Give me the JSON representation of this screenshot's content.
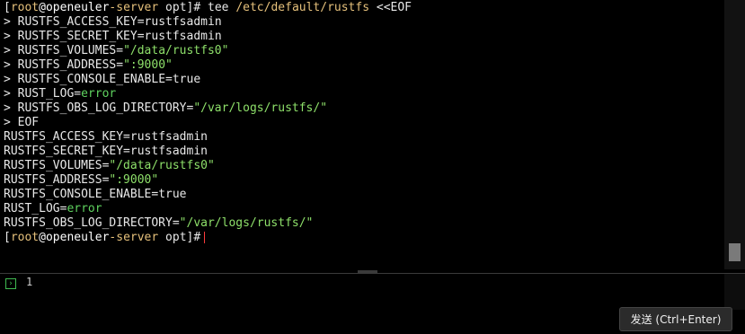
{
  "terminal": {
    "prompt": {
      "open": "[",
      "user": "root",
      "at": "@",
      "host_a": "openeuler",
      "dash": "-",
      "host_b": "server",
      "dir": " opt",
      "close": "]#"
    },
    "command_line": {
      "cmd": " tee ",
      "file": "/etc/default/rustfs",
      "heredoc": " <<EOF"
    },
    "heredoc_lines": [
      {
        "prefix": "> ",
        "key": "RUSTFS_ACCESS_KEY=",
        "value": "rustfsadmin",
        "style": "plain"
      },
      {
        "prefix": "> ",
        "key": "RUSTFS_SECRET_KEY=",
        "value": "rustfsadmin",
        "style": "plain"
      },
      {
        "prefix": "> ",
        "key": "RUSTFS_VOLUMES=",
        "value": "\"/data/rustfs0\"",
        "style": "str"
      },
      {
        "prefix": "> ",
        "key": "RUSTFS_ADDRESS=",
        "value": "\":9000\"",
        "style": "str"
      },
      {
        "prefix": "> ",
        "key": "RUSTFS_CONSOLE_ENABLE=",
        "value": "true",
        "style": "plain"
      },
      {
        "prefix": "> ",
        "key": "RUST_LOG=",
        "value": "error",
        "style": "err"
      },
      {
        "prefix": "> ",
        "key": "RUSTFS_OBS_LOG_DIRECTORY=",
        "value": "\"/var/logs/rustfs/\"",
        "style": "str"
      }
    ],
    "heredoc_end": "> EOF",
    "output_lines": [
      {
        "key": "RUSTFS_ACCESS_KEY=",
        "value": "rustfsadmin",
        "style": "plain"
      },
      {
        "key": "RUSTFS_SECRET_KEY=",
        "value": "rustfsadmin",
        "style": "plain"
      },
      {
        "key": "RUSTFS_VOLUMES=",
        "value": "\"/data/rustfs0\"",
        "style": "str"
      },
      {
        "key": "RUSTFS_ADDRESS=",
        "value": "\":9000\"",
        "style": "str"
      },
      {
        "key": "RUSTFS_CONSOLE_ENABLE=",
        "value": "true",
        "style": "plain"
      },
      {
        "key": "RUST_LOG=",
        "value": "error",
        "style": "err"
      },
      {
        "key": "RUSTFS_OBS_LOG_DIRECTORY=",
        "value": "\"/var/logs/rustfs/\"",
        "style": "str"
      }
    ]
  },
  "input_panel": {
    "prompt_icon": "terminal-prompt-icon",
    "prompt_glyph": "›",
    "line_number": "1",
    "send_label": "发送 (Ctrl+Enter)"
  },
  "colors": {
    "background": "#000000",
    "user": "#e5c07b",
    "string": "#8ee06a",
    "error_value": "#5fd35f",
    "cursor": "#ff3b3b"
  }
}
